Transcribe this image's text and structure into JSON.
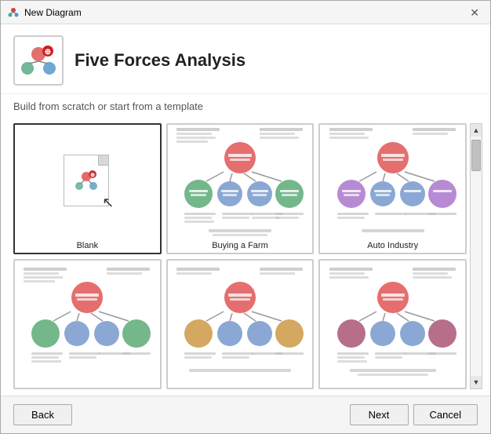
{
  "titlebar": {
    "title": "New Diagram",
    "close_label": "✕"
  },
  "header": {
    "title": "Five Forces Analysis"
  },
  "subtitle": "Build from scratch or start from a template",
  "templates": [
    {
      "id": "blank",
      "label": "Blank",
      "selected": true
    },
    {
      "id": "buying-a-farm",
      "label": "Buying a Farm",
      "selected": false
    },
    {
      "id": "auto-industry",
      "label": "Auto Industry",
      "selected": false
    },
    {
      "id": "template-4",
      "label": "",
      "selected": false
    },
    {
      "id": "template-5",
      "label": "",
      "selected": false
    },
    {
      "id": "template-6",
      "label": "",
      "selected": false
    }
  ],
  "footer": {
    "back_label": "Back",
    "next_label": "Next",
    "cancel_label": "Cancel"
  }
}
